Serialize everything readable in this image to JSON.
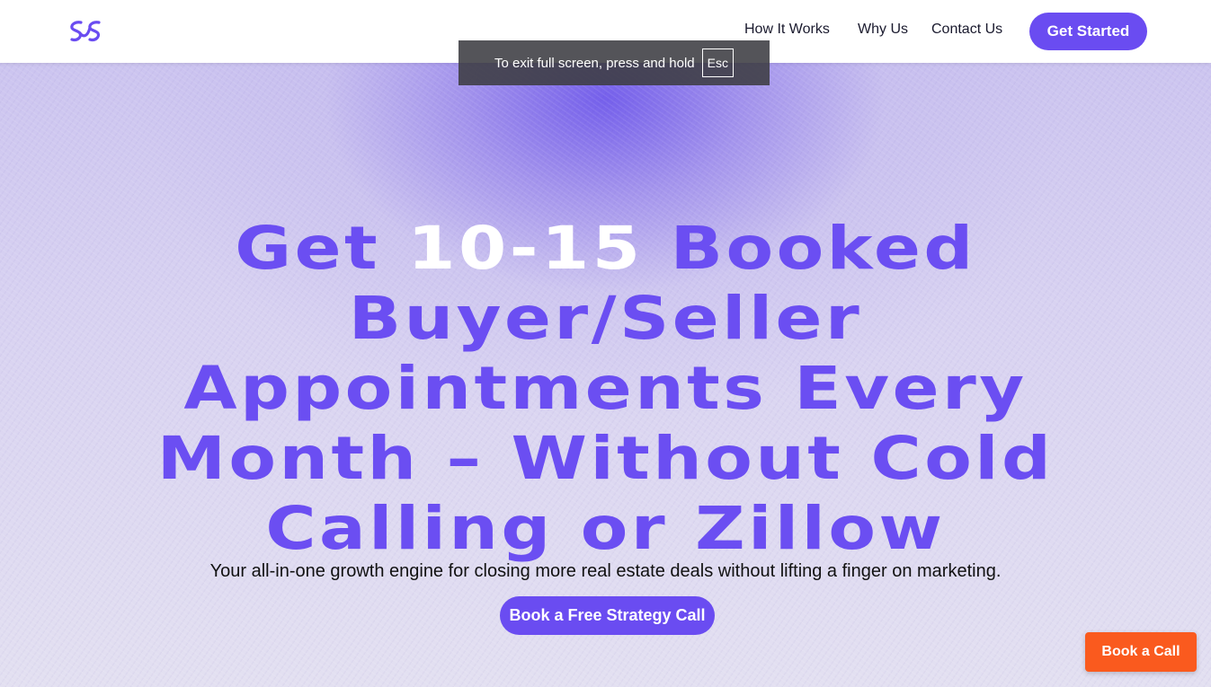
{
  "header": {
    "logo_icon": "double-s-link-logo",
    "nav": {
      "how_it_works": "How It Works",
      "why_us": "Why Us",
      "contact_us": "Contact Us"
    },
    "get_started_label": "Get Started"
  },
  "fullscreen_notice": {
    "text": "To exit full screen, press and hold",
    "key": "Esc"
  },
  "hero": {
    "headline_part1": "Get",
    "headline_highlight": "10-15",
    "headline_part2": "Booked",
    "headline_line2": "Buyer/Seller",
    "headline_line3": "Appointments Every",
    "headline_line4": "Month – Without Cold",
    "headline_line5": "Calling or Zillow",
    "subheadline": "Your all-in-one growth engine for closing more real estate deals without lifting a finger on marketing.",
    "cta_label": "Book a Free Strategy Call"
  },
  "floating_cta": {
    "label": "Book a Call"
  },
  "colors": {
    "brand_purple": "#6a4cf1",
    "headline_purple": "#6b4ef2",
    "highlight_white": "#ffffff",
    "floating_orange": "#fa5a1e",
    "header_bg": "#ffffff"
  }
}
